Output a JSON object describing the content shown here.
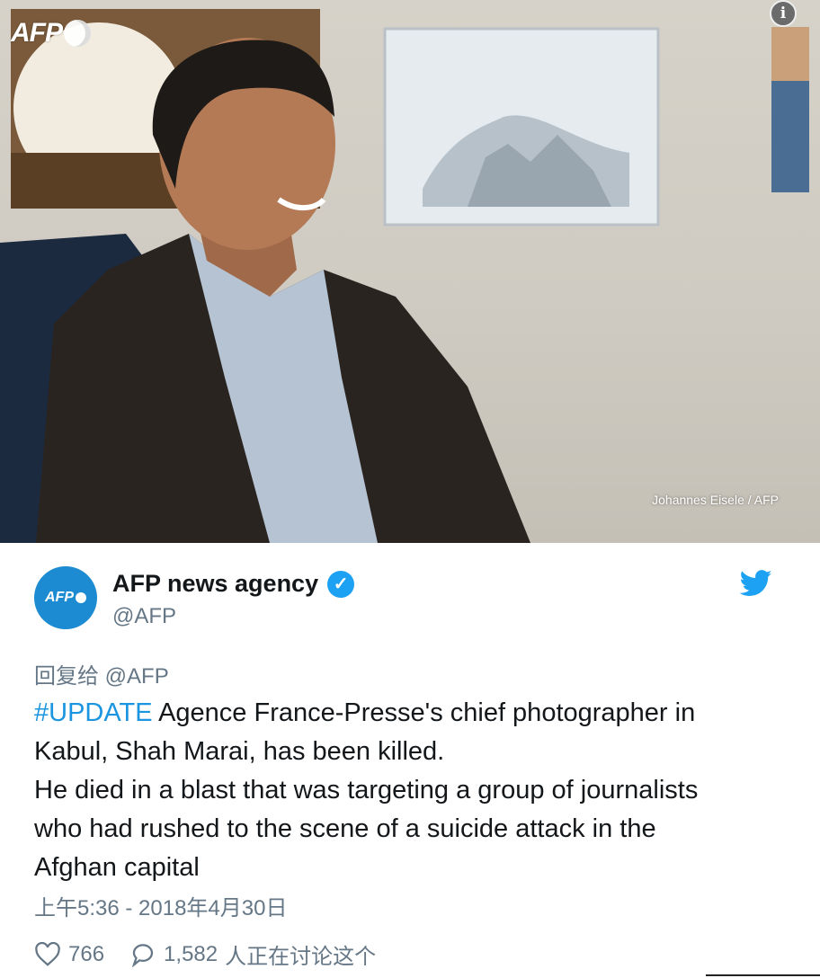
{
  "photo": {
    "logo_text": "AFP",
    "credit": "Johannes Eisele / AFP",
    "info_icon": "i"
  },
  "tweet": {
    "avatar_text": "AFP",
    "display_name": "AFP news agency",
    "handle": "@AFP",
    "verified_icon": "verified-badge-icon",
    "brand_icon": "twitter-bird-icon",
    "reply_to": "回复给 @AFP",
    "hashtag": "#UPDATE",
    "text_line1_rest": " Agence France-Presse's chief photographer in",
    "text_line2": "Kabul, Shah Marai, has been killed.",
    "text_line3": "He died in a blast that was targeting a group of journalists",
    "text_line4": "who had rushed to the scene of a suicide attack in the",
    "text_line5": "Afghan capital",
    "timestamp": "上午5:36 - 2018年4月30日",
    "likes": "766",
    "replies": "1,582",
    "discussing": "人正在讨论这个"
  },
  "colors": {
    "link": "#1b95e0",
    "twitter_blue": "#1da1f2",
    "secondary_text": "#657786",
    "afp_blue": "#1c8bd1"
  }
}
